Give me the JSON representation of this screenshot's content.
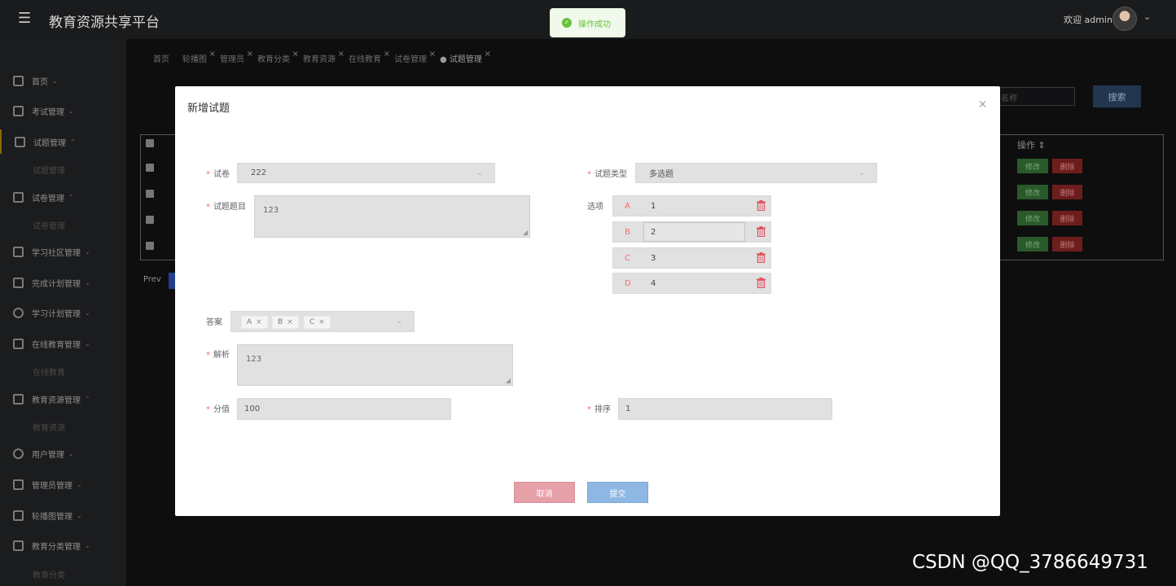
{
  "header": {
    "title": "教育资源共享平台",
    "welcome": "欢迎 admin"
  },
  "toast": {
    "message": "操作成功"
  },
  "sidebar": {
    "items": [
      {
        "label": "首页"
      },
      {
        "label": "考试管理"
      },
      {
        "label": "试题管理"
      },
      {
        "label": "试卷管理"
      },
      {
        "label": "学习社区管理"
      },
      {
        "label": "完成计划管理"
      },
      {
        "label": "学习计划管理"
      },
      {
        "label": "在线教育管理"
      },
      {
        "label": "教育资源管理"
      },
      {
        "label": "用户管理"
      },
      {
        "label": "管理员管理"
      },
      {
        "label": "轮播图管理"
      },
      {
        "label": "教育分类管理"
      }
    ],
    "subs": [
      "试题管理",
      "试卷管理",
      "在线教育",
      "教育资源",
      "教育分类"
    ]
  },
  "tabs": [
    {
      "label": "首页"
    },
    {
      "label": "轮播图"
    },
    {
      "label": "管理员"
    },
    {
      "label": "教育分类"
    },
    {
      "label": "教育资源"
    },
    {
      "label": "在线教育"
    },
    {
      "label": "试卷管理"
    },
    {
      "label": "试题管理"
    }
  ],
  "background": {
    "search_placeholder": "名称",
    "search_button": "搜索",
    "ops_header": "操作",
    "edit_label": "修改",
    "delete_label": "删除",
    "prev_label": "Prev"
  },
  "dialog": {
    "title": "新增试题",
    "paper_label": "试卷",
    "paper_value": "222",
    "type_label": "试题类型",
    "type_value": "多选题",
    "question_label": "试题题目",
    "question_value": "123",
    "options_label": "选项",
    "options": [
      {
        "letter": "A",
        "value": "1"
      },
      {
        "letter": "B",
        "value": "2"
      },
      {
        "letter": "C",
        "value": "3"
      },
      {
        "letter": "D",
        "value": "4"
      }
    ],
    "answer_label": "答案",
    "answer_tags": [
      "A",
      "B",
      "C"
    ],
    "analysis_label": "解析",
    "analysis_value": "123",
    "score_label": "分值",
    "score_value": "100",
    "order_label": "排序",
    "order_value": "1",
    "cancel_label": "取消",
    "submit_label": "提交"
  },
  "watermark": "CSDN @QQ_3786649731",
  "colors": {
    "required": "#f56c6c",
    "success": "#67c23a",
    "cancel": "#e5a0a8",
    "submit": "#8fb7e3"
  }
}
